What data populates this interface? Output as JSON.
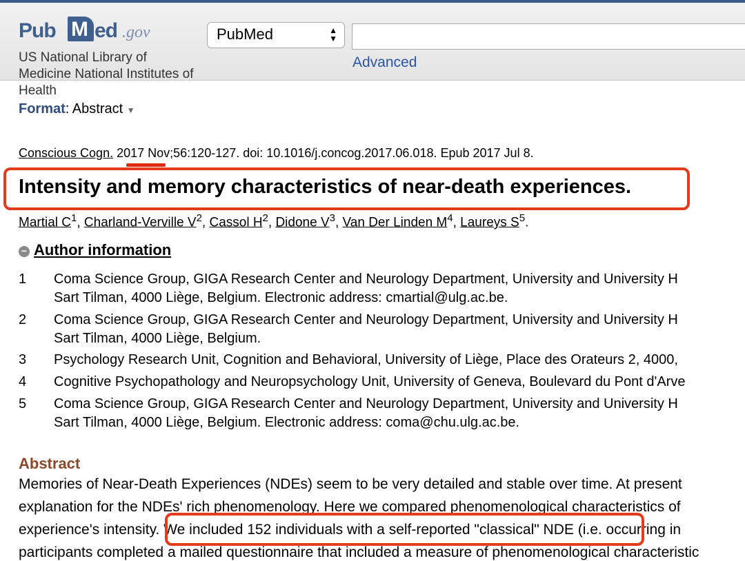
{
  "header": {
    "logo": {
      "pub": "Pub",
      "m": "M",
      "ed": "ed",
      "gov": ".gov"
    },
    "nlm_text": "US National Library of Medicine National Institutes of Health",
    "db_select_value": "PubMed",
    "search_value": "",
    "advanced_link": "Advanced"
  },
  "format": {
    "label": "Format",
    "value": ": Abstract"
  },
  "citation": {
    "journal": "Conscious Cogn.",
    "year": "2017",
    "rest": " Nov;56:120-127. doi: 10.1016/j.concog.2017.06.018. Epub 2017 Jul 8."
  },
  "article_title": "Intensity and memory characteristics of near-death experiences.",
  "authors": [
    {
      "name": "Martial C",
      "sup": "1"
    },
    {
      "name": "Charland-Verville V",
      "sup": "2"
    },
    {
      "name": "Cassol H",
      "sup": "2"
    },
    {
      "name": "Didone V",
      "sup": "3"
    },
    {
      "name": "Van Der Linden M",
      "sup": "4"
    },
    {
      "name": "Laureys S",
      "sup": "5"
    }
  ],
  "author_info_heading": "Author information",
  "affiliations": [
    {
      "num": "1",
      "line1": "Coma Science Group, GIGA Research Center and Neurology Department, University and University H",
      "line2": "Sart Tilman, 4000 Liège, Belgium. Electronic address: cmartial@ulg.ac.be."
    },
    {
      "num": "2",
      "line1": "Coma Science Group, GIGA Research Center and Neurology Department, University and University H",
      "line2": "Sart Tilman, 4000 Liège, Belgium."
    },
    {
      "num": "3",
      "line1": "Psychology Research Unit, Cognition and Behavioral, University of Liège, Place des Orateurs 2, 4000,"
    },
    {
      "num": "4",
      "line1": "Cognitive Psychopathology and Neuropsychology Unit, University of Geneva, Boulevard du Pont d'Arve"
    },
    {
      "num": "5",
      "line1": "Coma Science Group, GIGA Research Center and Neurology Department, University and University H",
      "line2": "Sart Tilman, 4000 Liège, Belgium. Electronic address: coma@chu.ulg.ac.be."
    }
  ],
  "abstract": {
    "heading": "Abstract",
    "lines": [
      "Memories of Near-Death Experiences (NDEs) seem to be very detailed and stable over time. At present",
      "explanation for the NDEs' rich phenomenology. Here we compared phenomenological characteristics of",
      "experience's intensity. We included 152 individuals with a self-reported \"classical\" NDE (i.e. occurring in",
      "participants completed a mailed questionnaire that included a measure of phenomenological characteristic"
    ]
  },
  "colors": {
    "highlight": "#e43b1c",
    "link_blue": "#2a54a4",
    "logo_blue": "#3f5f8e",
    "abstract_heading": "#8a4a2a"
  }
}
